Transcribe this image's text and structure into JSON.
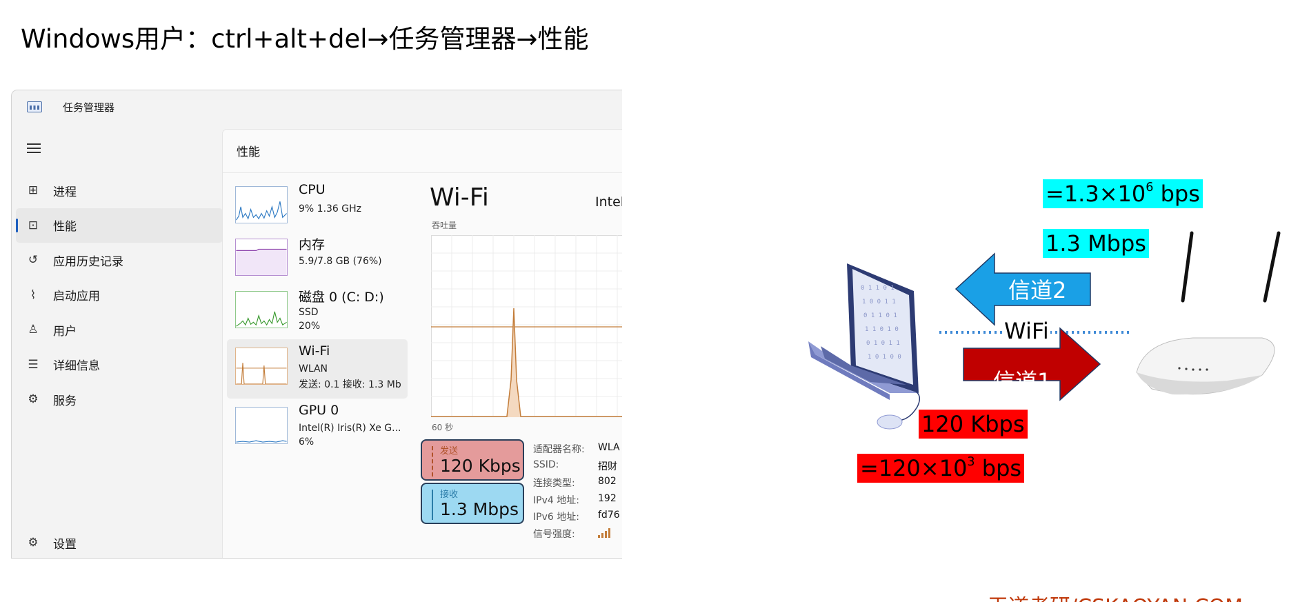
{
  "heading": "Windows用户：ctrl+alt+del→任务管理器→性能",
  "task_manager": {
    "title": "任务管理器",
    "nav": [
      {
        "label": "进程",
        "icon": "processes-icon",
        "glyph": "⊞"
      },
      {
        "label": "性能",
        "icon": "performance-icon",
        "glyph": "⊡"
      },
      {
        "label": "应用历史记录",
        "icon": "history-icon",
        "glyph": "↺"
      },
      {
        "label": "启动应用",
        "icon": "startup-icon",
        "glyph": "⌇"
      },
      {
        "label": "用户",
        "icon": "users-icon",
        "glyph": "♙"
      },
      {
        "label": "详细信息",
        "icon": "details-icon",
        "glyph": "☰"
      },
      {
        "label": "服务",
        "icon": "services-icon",
        "glyph": "⚙"
      }
    ],
    "active_nav": "性能",
    "settings_label": "设置",
    "content_title": "性能",
    "resources": [
      {
        "name": "CPU",
        "sub1": "9% 1.36 GHz",
        "sub2": ""
      },
      {
        "name": "内存",
        "sub1": "5.9/7.8 GB (76%)",
        "sub2": ""
      },
      {
        "name": "磁盘 0 (C: D:)",
        "sub1": "SSD",
        "sub2": "20%"
      },
      {
        "name": "Wi-Fi",
        "sub1": "WLAN",
        "sub2": "发送: 0.1 接收: 1.3 Mb"
      },
      {
        "name": "GPU 0",
        "sub1": "Intel(R) Iris(R) Xe G...",
        "sub2": "6%"
      }
    ],
    "detail": {
      "title": "Wi-Fi",
      "adapter": "Intel",
      "throughput_label": "吞吐量",
      "x_axis_label": "60 秒",
      "send": {
        "label": "发送",
        "value": "120 Kbps"
      },
      "receive": {
        "label": "接收",
        "value": "1.3 Mbps"
      },
      "properties": [
        {
          "key": "适配器名称:",
          "value": "WLA"
        },
        {
          "key": "SSID:",
          "value": "招财"
        },
        {
          "key": "连接类型:",
          "value": "802"
        },
        {
          "key": "IPv4 地址:",
          "value": "192"
        },
        {
          "key": "IPv6 地址:",
          "value": "fd76"
        },
        {
          "key": "信号强度:",
          "value": ""
        }
      ]
    }
  },
  "diagram": {
    "channel2": "信道2",
    "channel1": "信道1",
    "wifi": "WiFi",
    "rx_bps": "=1.3×10",
    "rx_exp": "6",
    "rx_unit": " bps",
    "rx_mbps": "1.3 Mbps",
    "tx_kbps": "120 Kbps",
    "tx_bps": "=120×10",
    "tx_exp": "3",
    "tx_unit": " bps",
    "colors": {
      "cyan": "#00ffff",
      "red": "#ff0000",
      "arrow_blue": "#1aa0e6",
      "arrow_red": "#c00000"
    }
  },
  "footer": "王道考研/CSKAOYAN.COM"
}
